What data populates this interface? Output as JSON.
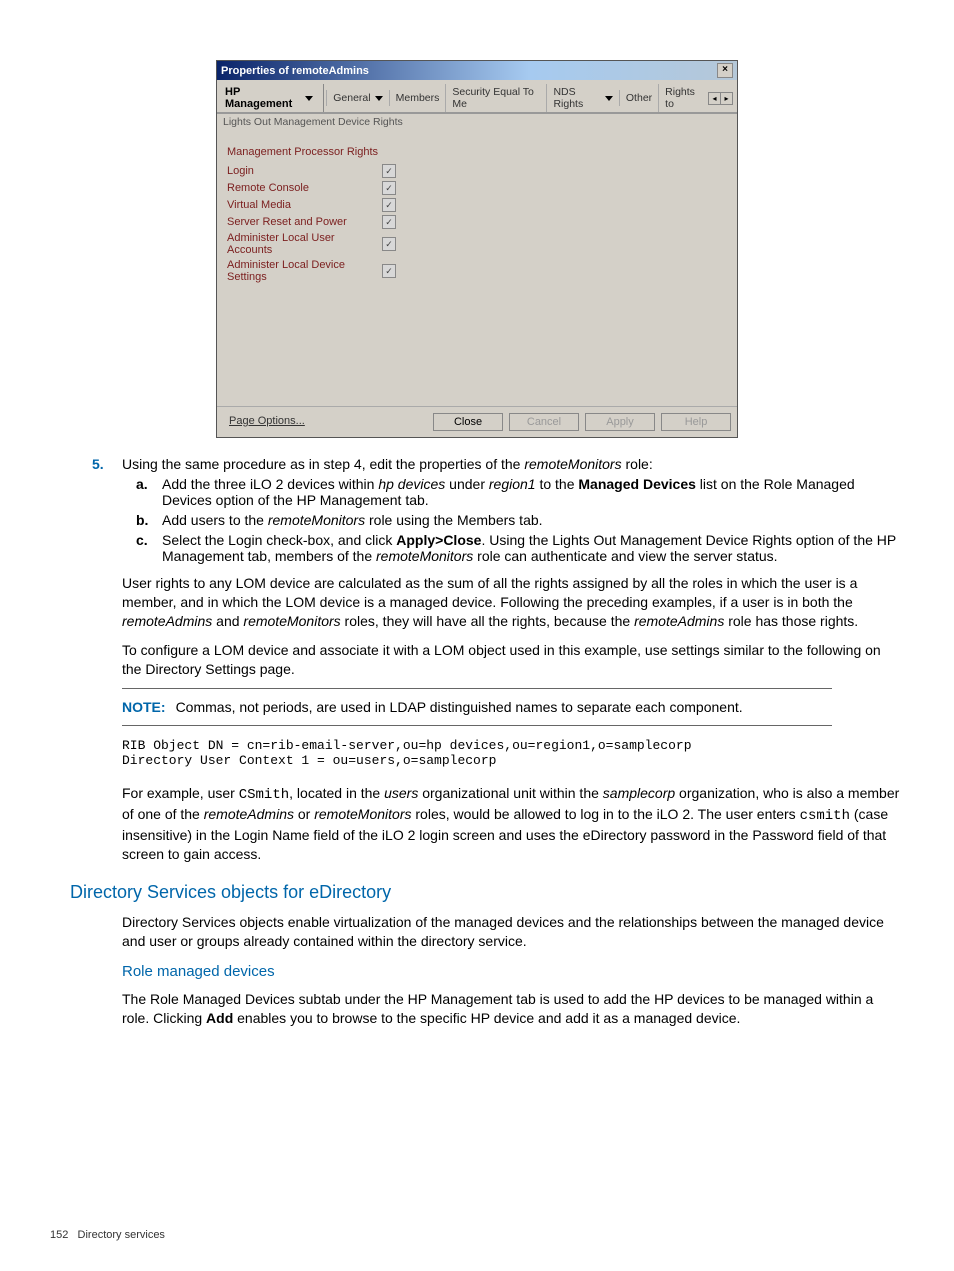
{
  "window": {
    "title": "Properties of remoteAdmins",
    "left_dropdown": "HP Management",
    "subtab": "Lights Out Management Device Rights",
    "tabs": [
      "General",
      "Members",
      "Security Equal To Me",
      "NDS Rights",
      "Other",
      "Rights to"
    ],
    "section_title": "Management Processor Rights",
    "rights": [
      {
        "label": "Login",
        "checked": true
      },
      {
        "label": "Remote Console",
        "checked": true
      },
      {
        "label": "Virtual Media",
        "checked": true
      },
      {
        "label": "Server Reset and Power",
        "checked": true
      },
      {
        "label": "Administer Local User Accounts",
        "checked": true
      },
      {
        "label": "Administer Local Device Settings",
        "checked": true
      }
    ],
    "page_options": "Page Options...",
    "buttons": {
      "close": "Close",
      "cancel": "Cancel",
      "apply": "Apply",
      "help": "Help"
    }
  },
  "step5": {
    "num": "5.",
    "text_pre": "Using the same procedure as in step 4, edit the properties of the ",
    "role": "remoteMonitors",
    "text_post": " role:",
    "a_pre": "Add the three iLO 2 devices within ",
    "a_i1": "hp devices",
    "a_mid": " under ",
    "a_i2": "region1",
    "a_mid2": " to the ",
    "a_b": "Managed Devices",
    "a_post": " list on the Role Managed Devices option of the HP Management tab.",
    "b_pre": "Add users to the ",
    "b_i": "remoteMonitors",
    "b_post": " role using the Members tab.",
    "c_pre": "Select the Login check-box, and click ",
    "c_b": "Apply>Close",
    "c_mid": ". Using the Lights Out Management Device Rights option of the HP Management tab, members of the ",
    "c_i": "remoteMonitors",
    "c_post": " role can authenticate and view the server status."
  },
  "p_rights": {
    "pre": "User rights to any LOM device are calculated as the sum of all the rights assigned by all the roles in which the user is a member, and in which the LOM device is a managed device. Following the preceding examples, if a user is in both the ",
    "i1": "remoteAdmins",
    "mid": " and ",
    "i2": "remoteMonitors",
    "mid2": " roles, they will have all the rights, because the ",
    "i3": "remoteAdmins",
    "post": " role has those rights."
  },
  "p_configure": "To configure a LOM device and associate it with a LOM object used in this example, use settings similar to the following on the Directory Settings page.",
  "note": {
    "label": "NOTE:",
    "text": "Commas, not periods, are used in LDAP distinguished names to separate each component."
  },
  "code": "RIB Object DN = cn=rib-email-server,ou=hp devices,ou=region1,o=samplecorp\nDirectory User Context 1 = ou=users,o=samplecorp",
  "p_example": {
    "pre": "For example, user ",
    "m1": "CSmith",
    "mid1": ", located in the ",
    "i1": "users",
    "mid2": " organizational unit within the ",
    "i2": "samplecorp",
    "mid3": " organization, who is also a member of one of the ",
    "i3": "remoteAdmins",
    "mid4": " or ",
    "i4": "remoteMonitors",
    "mid5": " roles, would be allowed to log in to the iLO 2. The user enters ",
    "m2": "csmith",
    "post": " (case insensitive) in the Login Name field of the iLO 2 login screen and uses the eDirectory password in the Password field of that screen to gain access."
  },
  "h2": "Directory Services objects for eDirectory",
  "p_dso": "Directory Services objects enable virtualization of the managed devices and the relationships between the managed device and user or groups already contained within the directory service.",
  "h3": "Role managed devices",
  "p_rmd": {
    "pre": "The Role Managed Devices subtab under the HP Management tab is used to add the HP devices to be managed within a role. Clicking ",
    "b": "Add",
    "post": " enables you to browse to the specific HP device and add it as a managed device."
  },
  "footer": {
    "page": "152",
    "chapter": "Directory services"
  }
}
